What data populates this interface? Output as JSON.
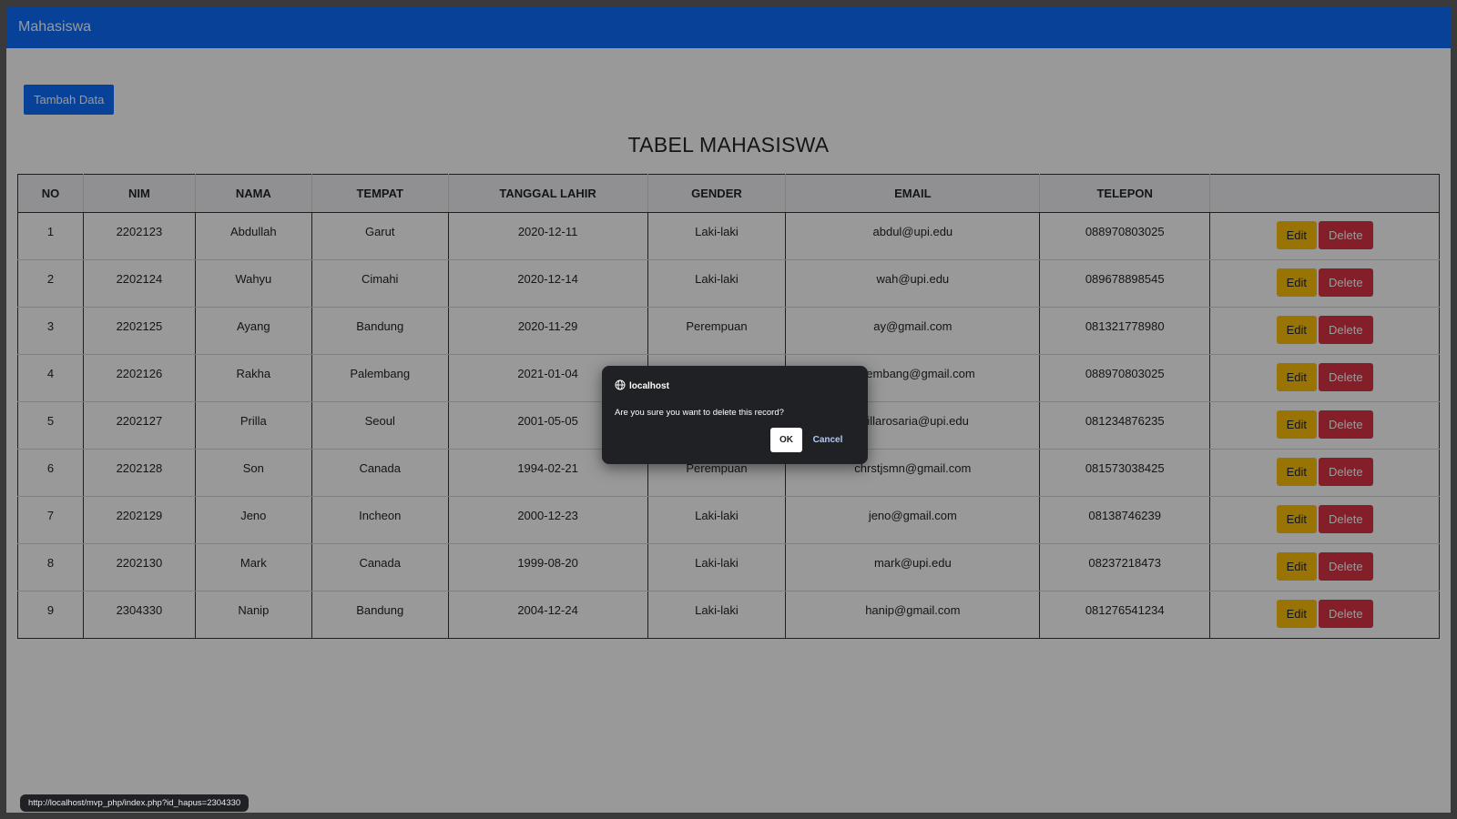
{
  "app": {
    "title": "Mahasiswa"
  },
  "main": {
    "add_button": "Tambah Data",
    "page_title": "TABEL MAHASISWA"
  },
  "table": {
    "headers": [
      "NO",
      "NIM",
      "NAMA",
      "TEMPAT",
      "TANGGAL LAHIR",
      "GENDER",
      "EMAIL",
      "TELEPON",
      ""
    ],
    "edit_label": "Edit",
    "delete_label": "Delete",
    "rows": [
      [
        "1",
        "2202123",
        "Abdullah",
        "Garut",
        "2020-12-11",
        "Laki-laki",
        "abdul@upi.edu",
        "088970803025"
      ],
      [
        "2",
        "2202124",
        "Wahyu",
        "Cimahi",
        "2020-12-14",
        "Laki-laki",
        "wah@upi.edu",
        "089678898545"
      ],
      [
        "3",
        "2202125",
        "Ayang",
        "Bandung",
        "2020-11-29",
        "Perempuan",
        "ay@gmail.com",
        "081321778980"
      ],
      [
        "4",
        "2202126",
        "Rakha",
        "Palembang",
        "2021-01-04",
        "",
        "palembang@gmail.com",
        "088970803025"
      ],
      [
        "5",
        "2202127",
        "Prilla",
        "Seoul",
        "2001-05-05",
        "",
        "prillarosaria@upi.edu",
        "081234876235"
      ],
      [
        "6",
        "2202128",
        "Son",
        "Canada",
        "1994-02-21",
        "Perempuan",
        "chrstjsmn@gmail.com",
        "081573038425"
      ],
      [
        "7",
        "2202129",
        "Jeno",
        "Incheon",
        "2000-12-23",
        "Laki-laki",
        "jeno@gmail.com",
        "08138746239"
      ],
      [
        "8",
        "2202130",
        "Mark",
        "Canada",
        "1999-08-20",
        "Laki-laki",
        "mark@upi.edu",
        "08237218473"
      ],
      [
        "9",
        "2304330",
        "Nanip",
        "Bandung",
        "2004-12-24",
        "Laki-laki",
        "hanip@gmail.com",
        "081276541234"
      ]
    ]
  },
  "dialog": {
    "origin": "localhost",
    "message": "Are you sure you want to delete this record?",
    "ok_label": "OK",
    "cancel_label": "Cancel"
  },
  "status": {
    "url": "http://localhost/mvp_php/index.php?id_hapus=2304330"
  },
  "colors": {
    "primary": "#0d6efd",
    "warning": "#ffc107",
    "danger": "#dc3545",
    "dialog_bg": "#202124"
  },
  "icons": {
    "dialog_origin": "globe-icon"
  }
}
